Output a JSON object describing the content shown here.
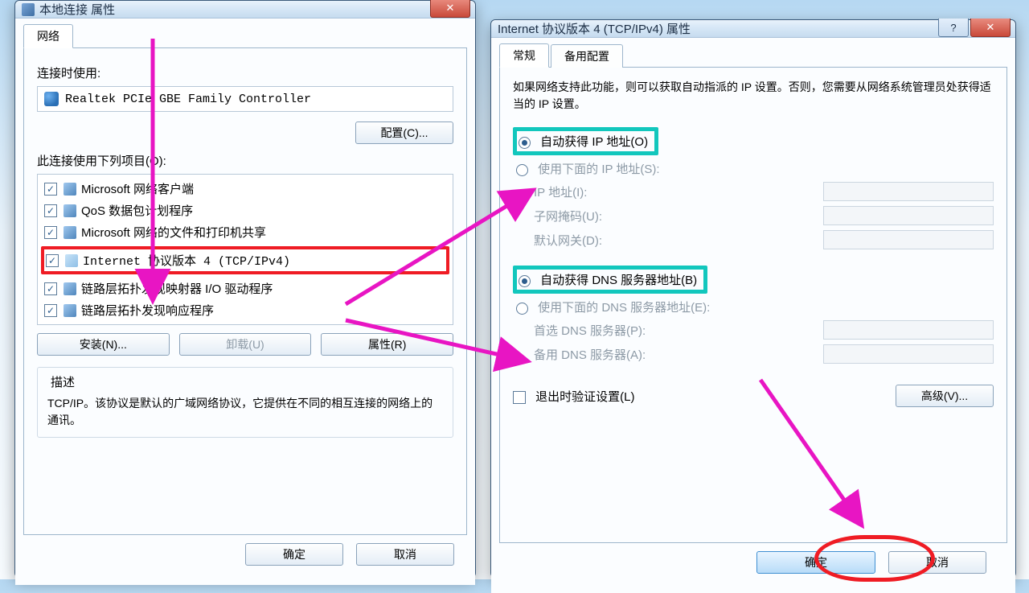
{
  "win1": {
    "title": "本地连接 属性",
    "tab_network": "网络",
    "connect_using": "连接时使用:",
    "adapter": "Realtek PCIe GBE Family Controller",
    "configure_btn": "配置(C)...",
    "uses_items": "此连接使用下列项目(O):",
    "items": [
      "Microsoft 网络客户端",
      "QoS 数据包计划程序",
      "Microsoft 网络的文件和打印机共享",
      "Internet 协议版本 4 (TCP/IPv4)",
      "链路层拓扑发现映射器 I/O 驱动程序",
      "链路层拓扑发现响应程序"
    ],
    "install_btn": "安装(N)...",
    "uninstall_btn": "卸载(U)",
    "properties_btn": "属性(R)",
    "desc_title": "描述",
    "desc_text": "TCP/IP。该协议是默认的广域网络协议，它提供在不同的相互连接的网络上的通讯。",
    "ok": "确定",
    "cancel": "取消"
  },
  "win2": {
    "title": "Internet 协议版本 4 (TCP/IPv4) 属性",
    "tab_general": "常规",
    "tab_alt": "备用配置",
    "intro": "如果网络支持此功能，则可以获取自动指派的 IP 设置。否则，您需要从网络系统管理员处获得适当的 IP 设置。",
    "auto_ip": "自动获得 IP 地址(O)",
    "manual_ip": "使用下面的 IP 地址(S):",
    "ip_addr": "IP 地址(I):",
    "subnet": "子网掩码(U):",
    "gateway": "默认网关(D):",
    "auto_dns": "自动获得 DNS 服务器地址(B)",
    "manual_dns": "使用下面的 DNS 服务器地址(E):",
    "pref_dns": "首选 DNS 服务器(P):",
    "alt_dns": "备用 DNS 服务器(A):",
    "validate": "退出时验证设置(L)",
    "advanced": "高级(V)...",
    "ok": "确定",
    "cancel": "取消"
  }
}
